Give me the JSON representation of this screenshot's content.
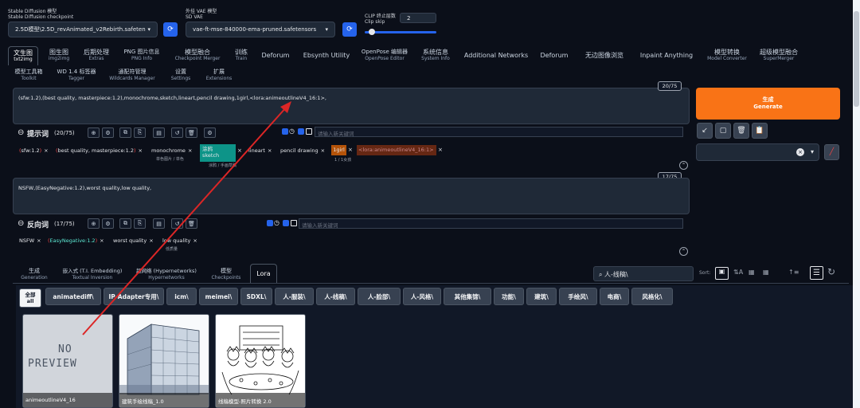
{
  "top": {
    "checkpoint_label_cn": "Stable Diffusion 模型",
    "checkpoint_label_en": "Stable Diffusion checkpoint",
    "checkpoint_value": "2.5D模型\\2.5D_revAnimated_v2Rebirth.safeten",
    "vae_label_cn": "外挂 VAE 模型",
    "vae_label_en": "SD VAE",
    "vae_value": "vae-ft-mse-840000-ema-pruned.safetensors",
    "clip_label_cn": "CLIP 终止层数",
    "clip_label_en": "Clip skip",
    "clip_value": "2",
    "clip_fraction": 0.1
  },
  "tabs_row1": [
    {
      "cn": "文生图",
      "en": "txt2img"
    },
    {
      "cn": "图生图",
      "en": "img2img"
    },
    {
      "cn": "后期处理",
      "en": "Extras"
    },
    {
      "cn": "PNG 图片信息",
      "en": "PNG Info"
    },
    {
      "cn": "模型融合",
      "en": "Checkpoint Merger"
    },
    {
      "cn": "训练",
      "en": "Train"
    },
    {
      "cn": "Deforum",
      "en": ""
    },
    {
      "cn": "Ebsynth Utility",
      "en": ""
    },
    {
      "cn": "OpenPose 编辑器",
      "en": "OpenPose Editor"
    },
    {
      "cn": "系统信息",
      "en": "System Info"
    },
    {
      "cn": "Additional Networks",
      "en": ""
    },
    {
      "cn": "Deforum",
      "en": ""
    },
    {
      "cn": "无边图像浏览",
      "en": ""
    },
    {
      "cn": "Inpaint Anything",
      "en": ""
    },
    {
      "cn": "模型转换",
      "en": "Model Converter"
    },
    {
      "cn": "超级模型融合",
      "en": "SuperMerger"
    }
  ],
  "tabs_row2": [
    {
      "cn": "模型工具箱",
      "en": "Toolkit"
    },
    {
      "cn": "WD 1.4 标签器",
      "en": "Tagger"
    },
    {
      "cn": "通配符管理",
      "en": "Wildcards Manager"
    },
    {
      "cn": "设置",
      "en": "Settings"
    },
    {
      "cn": "扩展",
      "en": "Extensions"
    }
  ],
  "prompt": {
    "text": "(sfw:1.2),(best quality, masterpiece:1.2),monochrome,sketch,lineart,pencil drawing,1girl,<lora:animeoutlineV4_16:1>,",
    "counter": "20/75",
    "label": "提示词",
    "label_count": "(20/75)",
    "new_keyword_placeholder": "请输入新关键词",
    "chips": [
      {
        "pre": "(",
        "text": "sfw:1.2",
        "post": ")"
      },
      {
        "pre": "(",
        "text": "best quality, masterpiece:1.2",
        "post": ")"
      },
      {
        "text": "monochrome",
        "sub": "单色图片 / 单色"
      },
      {
        "text": "涂鸦",
        "text2": "sketch",
        "sub": "涂鸦 / 手画草稿"
      },
      {
        "text": "lineart"
      },
      {
        "text": "pencil drawing"
      },
      {
        "text": "1girl",
        "sub": "1 / 1女孩"
      },
      {
        "text": "<lora:animeoutlineV4_16:1>"
      }
    ]
  },
  "negative": {
    "text": "NSFW,(EasyNegative:1.2),worst quality,low quality,",
    "counter": "17/75",
    "label": "反向词",
    "label_count": "(17/75)",
    "new_keyword_placeholder": "请输入新关键词",
    "chips": [
      {
        "text": "NSFW"
      },
      {
        "pre": "(",
        "text": "EasyNegative:1.2",
        "post": ")"
      },
      {
        "text": "worst quality"
      },
      {
        "text": "low quality",
        "sub": "低质量"
      }
    ]
  },
  "generate": {
    "cn": "生成",
    "en": "Generate"
  },
  "network_tabs": [
    {
      "cn": "生成",
      "en": "Generation"
    },
    {
      "cn": "嵌入式 (T.I. Embedding)",
      "en": "Textual Inversion"
    },
    {
      "cn": "超网络 (Hypernetworks)",
      "en": "Hypernetworks"
    },
    {
      "cn": "模型",
      "en": "Checkpoints"
    },
    {
      "cn": "Lora",
      "en": ""
    }
  ],
  "search": {
    "value": "人-线稿\\"
  },
  "sort_label": "Sort:",
  "filters": [
    "全部\nall",
    "animatediff\\",
    "IP-Adapter专用\\",
    "icm\\",
    "meimei\\",
    "SDXL\\",
    "人-服装\\",
    "人-线稿\\",
    "人-脸部\\",
    "人-风格\\",
    "其他集锦\\",
    "功能\\",
    "建筑\\",
    "手绘风\\",
    "电商\\",
    "风格化\\"
  ],
  "cards": [
    {
      "title": "animeoutlineV4_16",
      "placeholder1": "NO",
      "placeholder2": "PREVIEW"
    },
    {
      "title": "建筑手绘线稿_1.0"
    },
    {
      "title": "线稿模型-照片转换 2.0"
    }
  ],
  "colors": {
    "accent": "#f97316",
    "annotation": "#dc2626",
    "bg": "#0b0f19",
    "panel": "#1f2937"
  }
}
